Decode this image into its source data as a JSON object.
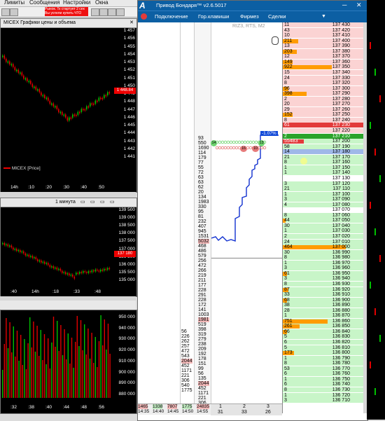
{
  "topbar": {
    "menu": [
      "Лимиты",
      "Сообщения",
      "Настройки",
      "Окна"
    ],
    "alert_line1": "Рынок. Тк стартует 2 сек",
    "alert_line2": "Вы успели купить ЧТО"
  },
  "chart1": {
    "title": "MICEX Графики цены и объема",
    "legend": "MICEX [Price]",
    "price_ticks": [
      "1 457",
      "1 456",
      "1 455",
      "1 454",
      "1 453",
      "1 452",
      "1 451",
      "1 450",
      "1 449",
      "1 448",
      "1 447",
      "1 446",
      "1 445",
      "1 444",
      "1 443",
      "1 442",
      "1 441"
    ],
    "highlight": "1 448.84",
    "time_ticks": [
      "14h",
      ":10",
      ":20",
      ":30",
      ":40",
      ":50"
    ]
  },
  "chart2": {
    "title": "1 минута",
    "price_ticks": [
      "139 500",
      "139 000",
      "138 500",
      "138 000",
      "137 500",
      "137 000",
      "136 500",
      "136 000",
      "135 500",
      "135 000"
    ],
    "highlight": "137 180",
    "time_ticks": [
      ":40",
      "14h",
      ":18",
      ":33",
      ":48"
    ]
  },
  "chart3": {
    "volume_ticks": [
      "950 000",
      "940 000",
      "930 000",
      "920 000",
      "910 000",
      "900 000",
      "890 000",
      "880 000"
    ],
    "time_ticks": [
      ":32",
      ":38",
      ":40",
      ":44",
      ":48",
      ":56"
    ]
  },
  "mainwin": {
    "title": "Привод Бондаря™ v2.6.5017",
    "logo": "A",
    "menu": [
      "Подключение",
      "Гор.клавиши",
      "Фирмез",
      "Сделки"
    ],
    "instrument": "RIZ3, RTS, M2",
    "percent_badge": "-1.07%",
    "level_bubbles": [
      "14",
      "10",
      "16",
      "13"
    ]
  },
  "clusters": {
    "col1": [
      "93",
      "550",
      "1690",
      "114",
      "179",
      "77",
      "55",
      "72",
      "63",
      "63",
      "62",
      "20",
      "134",
      "1983",
      "330",
      "95",
      "81",
      "232",
      "407",
      "945",
      "1531",
      "5032",
      "468",
      "486",
      "579",
      "256",
      "472",
      "266",
      "219",
      "211",
      "177",
      "228",
      "291",
      "228",
      "172",
      "141",
      "1003",
      "1981",
      "519",
      "398",
      "319",
      "279",
      "238",
      "209",
      "192",
      "178",
      "151",
      "99",
      "56",
      "135",
      "2044",
      "452",
      "1171",
      "221",
      "306",
      "540",
      "1775"
    ],
    "col2": [
      "56",
      "226",
      "262",
      "257",
      "472",
      "543",
      "2044",
      "452",
      "1171",
      "221",
      "306",
      "540",
      "1775"
    ],
    "footer_cells": [
      "1465",
      "1338",
      "7807",
      "1775",
      "24835"
    ],
    "footer_times": [
      "14:35",
      "14:40",
      "14:45",
      "14:50",
      "14:55"
    ],
    "bottom_tabs": [
      "1",
      "2",
      "3"
    ],
    "bottom_values": [
      "31",
      "33",
      "26"
    ]
  },
  "orderbook": {
    "rows": [
      {
        "q": "11",
        "p": "137 430",
        "side": "ask",
        "bar": 0
      },
      {
        "q": "43",
        "p": "137 420",
        "side": "ask",
        "bar": 0
      },
      {
        "q": "10",
        "p": "137 410",
        "side": "ask",
        "bar": 0
      },
      {
        "q": "211",
        "p": "137 400",
        "side": "ask",
        "bar": 22
      },
      {
        "q": "13",
        "p": "137 390",
        "side": "ask",
        "bar": 0
      },
      {
        "q": "203",
        "p": "137 380",
        "side": "ask",
        "bar": 20
      },
      {
        "q": "12",
        "p": "137 370",
        "side": "ask",
        "bar": 0
      },
      {
        "q": "149",
        "p": "137 360",
        "side": "ask",
        "bar": 14
      },
      {
        "q": "922",
        "p": "137 350",
        "side": "ask",
        "bar": 70
      },
      {
        "q": "15",
        "p": "137 340",
        "side": "ask",
        "bar": 0
      },
      {
        "q": "24",
        "p": "137 330",
        "side": "ask",
        "bar": 0
      },
      {
        "q": "8",
        "p": "137 320",
        "side": "ask",
        "bar": 0
      },
      {
        "q": "96",
        "p": "137 300",
        "side": "ask",
        "bar": 8
      },
      {
        "q": "398",
        "p": "137 290",
        "side": "ask",
        "bar": 34
      },
      {
        "q": "2",
        "p": "137 280",
        "side": "ask",
        "bar": 0
      },
      {
        "q": "20",
        "p": "137 270",
        "side": "ask",
        "bar": 0
      },
      {
        "q": "29",
        "p": "137 260",
        "side": "ask",
        "bar": 0
      },
      {
        "q": "152",
        "p": "137 250",
        "side": "ask",
        "bar": 14
      },
      {
        "q": "8",
        "p": "137 240",
        "side": "ask",
        "bar": 0
      },
      {
        "q": "61",
        "p": "137 230",
        "side": "best-ask",
        "bar": 0
      },
      {
        "q": "",
        "p": "137 220",
        "side": "ask",
        "bar": 0
      },
      {
        "q": "2",
        "p": "137 210",
        "side": "best",
        "bar": 0
      },
      {
        "q": "55483",
        "p": "137 200",
        "side": "big",
        "bar": 0
      },
      {
        "q": "58",
        "p": "137 190",
        "side": "bid",
        "bar": 0
      },
      {
        "q": "14",
        "p": "137 180",
        "side": "cursor",
        "bar": 0
      },
      {
        "q": "21",
        "p": "137 170",
        "side": "bid",
        "bar": 0
      },
      {
        "q": "8",
        "p": "137 160",
        "side": "bid",
        "bar": 0
      },
      {
        "q": "1",
        "p": "137 150",
        "side": "bid",
        "bar": 0
      },
      {
        "q": "1",
        "p": "137 140",
        "side": "bid",
        "bar": 0
      },
      {
        "q": "",
        "p": "137 130",
        "side": "blank",
        "bar": 0
      },
      {
        "q": "3",
        "p": "137 120",
        "side": "bid",
        "bar": 0
      },
      {
        "q": "21",
        "p": "137 110",
        "side": "bid",
        "bar": 0
      },
      {
        "q": "1",
        "p": "137 100",
        "side": "bid",
        "bar": 0
      },
      {
        "q": "3",
        "p": "137 090",
        "side": "bid",
        "bar": 0
      },
      {
        "q": "4",
        "p": "137 080",
        "side": "bid",
        "bar": 0
      },
      {
        "q": "",
        "p": "137 070",
        "side": "blank",
        "bar": 0
      },
      {
        "q": "8",
        "p": "137 060",
        "side": "bid",
        "bar": 0
      },
      {
        "q": "44",
        "p": "137 050",
        "side": "bid",
        "bar": 4
      },
      {
        "q": "30",
        "p": "137 040",
        "side": "bid",
        "bar": 0
      },
      {
        "q": "1",
        "p": "137 030",
        "side": "bid",
        "bar": 0
      },
      {
        "q": "2",
        "p": "137 020",
        "side": "bid",
        "bar": 0
      },
      {
        "q": "24",
        "p": "137 010",
        "side": "bid",
        "bar": 0
      },
      {
        "q": "464",
        "p": "137 000",
        "side": "bid",
        "bar": 90
      },
      {
        "q": "30",
        "p": "136 990",
        "side": "bid",
        "bar": 0
      },
      {
        "q": "8",
        "p": "136 980",
        "side": "bid",
        "bar": 0
      },
      {
        "q": "1",
        "p": "136 970",
        "side": "bid",
        "bar": 0
      },
      {
        "q": "3",
        "p": "136 960",
        "side": "bid",
        "bar": 0
      },
      {
        "q": "61",
        "p": "136 950",
        "side": "bid",
        "bar": 6
      },
      {
        "q": "3",
        "p": "136 940",
        "side": "bid",
        "bar": 0
      },
      {
        "q": "8",
        "p": "136 930",
        "side": "bid",
        "bar": 0
      },
      {
        "q": "87",
        "p": "136 920",
        "side": "bid",
        "bar": 8
      },
      {
        "q": "33",
        "p": "136 910",
        "side": "bid",
        "bar": 0
      },
      {
        "q": "68",
        "p": "136 900",
        "side": "bid",
        "bar": 6
      },
      {
        "q": "38",
        "p": "136 890",
        "side": "bid",
        "bar": 0
      },
      {
        "q": "28",
        "p": "136 880",
        "side": "bid",
        "bar": 0
      },
      {
        "q": "1",
        "p": "136 870",
        "side": "bid",
        "bar": 0
      },
      {
        "q": "751",
        "p": "136 860",
        "side": "bid",
        "bar": 64
      },
      {
        "q": "261",
        "p": "136 850",
        "side": "bid",
        "bar": 24
      },
      {
        "q": "66",
        "p": "136 840",
        "side": "bid",
        "bar": 6
      },
      {
        "q": "5",
        "p": "136 830",
        "side": "bid",
        "bar": 0
      },
      {
        "q": "6",
        "p": "136 820",
        "side": "bid",
        "bar": 0
      },
      {
        "q": "5",
        "p": "136 810",
        "side": "bid",
        "bar": 0
      },
      {
        "q": "173",
        "p": "136 800",
        "side": "bid",
        "bar": 16
      },
      {
        "q": "1",
        "p": "136 790",
        "side": "bid",
        "bar": 0
      },
      {
        "q": "8",
        "p": "136 780",
        "side": "bid",
        "bar": 0
      },
      {
        "q": "53",
        "p": "136 770",
        "side": "bid",
        "bar": 0
      },
      {
        "q": "6",
        "p": "136 760",
        "side": "bid",
        "bar": 0
      },
      {
        "q": "1",
        "p": "136 750",
        "side": "bid",
        "bar": 0
      },
      {
        "q": "6",
        "p": "136 740",
        "side": "bid",
        "bar": 0
      },
      {
        "q": "8",
        "p": "136 730",
        "side": "bid",
        "bar": 0
      },
      {
        "q": "1",
        "p": "136 720",
        "side": "bid",
        "bar": 0
      },
      {
        "q": "3",
        "p": "136 710",
        "side": "bid",
        "bar": 0
      }
    ]
  },
  "colors": {
    "title_blue": "#0c5fa3",
    "ask_bg": "#fbd3d3",
    "bid_bg": "#c8f5c8",
    "volume_bar": "#ff9c00",
    "best_ask": "#e23b3b",
    "best_bid": "#2aa32a",
    "cursor_row": "#9fb8e8",
    "candle_up": "#00c000",
    "candle_down": "#e00000",
    "price_line": "#1030d0"
  }
}
